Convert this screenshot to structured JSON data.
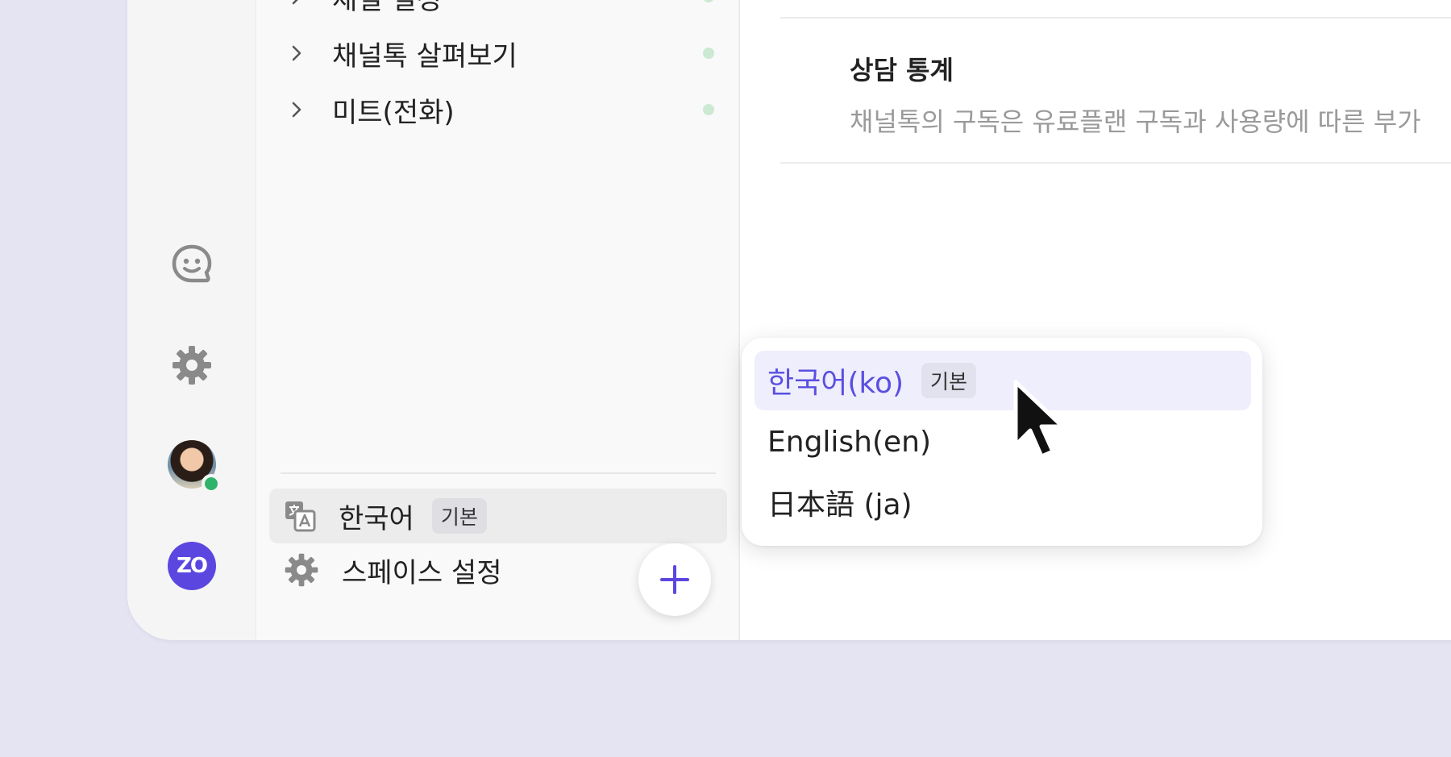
{
  "colors": {
    "accent": "#5b47e0",
    "online": "#2fb36a",
    "selected_bg": "#efeefc",
    "dot": "#cbe9d3"
  },
  "rail": {
    "icons": [
      "chat-face-icon",
      "gear-icon"
    ],
    "avatar_status": "online",
    "workspace_logo_text": "ZO"
  },
  "nav": {
    "items": [
      {
        "label": "채널 설정"
      },
      {
        "label": "채널톡 살펴보기"
      },
      {
        "label": "미트(전화)"
      }
    ],
    "language_row": {
      "label": "한국어",
      "badge": "기본"
    },
    "space_settings_label": "스페이스 설정"
  },
  "main": {
    "section_title": "상담 통계",
    "section_desc": "채널톡의 구독은 유료플랜 구독과 사용량에 따른 부가"
  },
  "language_menu": {
    "options": [
      {
        "label": "한국어(ko)",
        "badge": "기본",
        "selected": true
      },
      {
        "label": "English(en)",
        "selected": false
      },
      {
        "label": "日本語 (ja)",
        "selected": false
      }
    ]
  }
}
